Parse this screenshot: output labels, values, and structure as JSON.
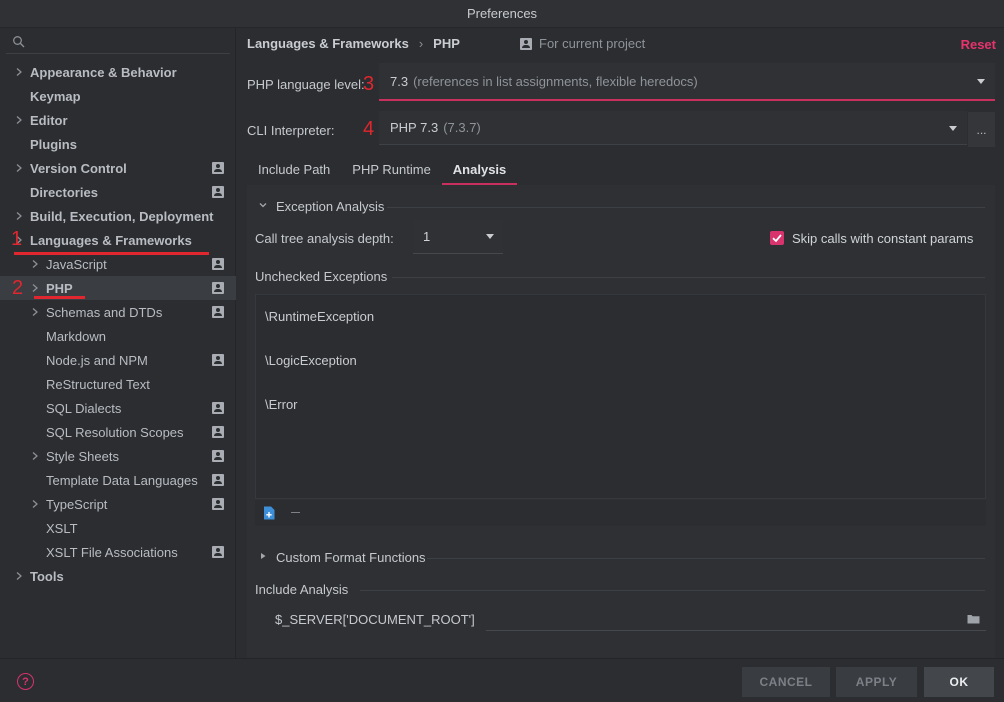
{
  "window": {
    "title": "Preferences"
  },
  "sidebar": {
    "search_placeholder": "",
    "items": [
      {
        "label": "Appearance & Behavior",
        "level": 0,
        "expandable": true,
        "bold": true,
        "project_icon": false
      },
      {
        "label": "Keymap",
        "level": 0,
        "expandable": false,
        "bold": true,
        "project_icon": false
      },
      {
        "label": "Editor",
        "level": 0,
        "expandable": true,
        "bold": true,
        "project_icon": false
      },
      {
        "label": "Plugins",
        "level": 0,
        "expandable": false,
        "bold": true,
        "project_icon": false
      },
      {
        "label": "Version Control",
        "level": 0,
        "expandable": true,
        "bold": true,
        "project_icon": true
      },
      {
        "label": "Directories",
        "level": 0,
        "expandable": false,
        "bold": true,
        "project_icon": true
      },
      {
        "label": "Build, Execution, Deployment",
        "level": 0,
        "expandable": true,
        "bold": true,
        "project_icon": false
      },
      {
        "label": "Languages & Frameworks",
        "level": 0,
        "expandable": true,
        "bold": true,
        "project_icon": false
      },
      {
        "label": "JavaScript",
        "level": 1,
        "expandable": true,
        "bold": false,
        "project_icon": true
      },
      {
        "label": "PHP",
        "level": 1,
        "expandable": true,
        "bold": true,
        "project_icon": true,
        "selected": true
      },
      {
        "label": "Schemas and DTDs",
        "level": 1,
        "expandable": true,
        "bold": false,
        "project_icon": true
      },
      {
        "label": "Markdown",
        "level": 1,
        "expandable": false,
        "bold": false,
        "project_icon": false
      },
      {
        "label": "Node.js and NPM",
        "level": 1,
        "expandable": false,
        "bold": false,
        "project_icon": true
      },
      {
        "label": "ReStructured Text",
        "level": 1,
        "expandable": false,
        "bold": false,
        "project_icon": false
      },
      {
        "label": "SQL Dialects",
        "level": 1,
        "expandable": false,
        "bold": false,
        "project_icon": true
      },
      {
        "label": "SQL Resolution Scopes",
        "level": 1,
        "expandable": false,
        "bold": false,
        "project_icon": true
      },
      {
        "label": "Style Sheets",
        "level": 1,
        "expandable": true,
        "bold": false,
        "project_icon": true
      },
      {
        "label": "Template Data Languages",
        "level": 1,
        "expandable": false,
        "bold": false,
        "project_icon": true
      },
      {
        "label": "TypeScript",
        "level": 1,
        "expandable": true,
        "bold": false,
        "project_icon": true
      },
      {
        "label": "XSLT",
        "level": 1,
        "expandable": false,
        "bold": false,
        "project_icon": false
      },
      {
        "label": "XSLT File Associations",
        "level": 1,
        "expandable": false,
        "bold": false,
        "project_icon": true
      },
      {
        "label": "Tools",
        "level": 0,
        "expandable": true,
        "bold": true,
        "project_icon": false
      }
    ]
  },
  "annotations": {
    "a1": "1",
    "a2": "2",
    "a3": "3",
    "a4": "4",
    "color": "#e0262e"
  },
  "header": {
    "crumb_parent": "Languages & Frameworks",
    "crumb_separator": "›",
    "crumb_current": "PHP",
    "scope_label": "For current project",
    "reset_label": "Reset"
  },
  "php_level": {
    "label": "PHP language level:",
    "value": "7.3",
    "description": "(references in list assignments, flexible heredocs)"
  },
  "cli": {
    "label": "CLI Interpreter:",
    "value": "PHP 7.3",
    "version": "(7.3.7)",
    "more_label": "..."
  },
  "tabs": [
    {
      "label": "Include Path",
      "active": false
    },
    {
      "label": "PHP Runtime",
      "active": false
    },
    {
      "label": "Analysis",
      "active": true
    }
  ],
  "analysis": {
    "exception_analysis_title": "Exception Analysis",
    "depth_label": "Call tree analysis depth:",
    "depth_value": "1",
    "skip_calls_label": "Skip calls with constant params",
    "skip_calls_checked": true,
    "unchecked_title": "Unchecked Exceptions",
    "unchecked_items": [
      "\\RuntimeException",
      "\\LogicException",
      "\\Error"
    ],
    "custom_format_title": "Custom Format Functions",
    "include_analysis_title": "Include Analysis",
    "include_var": "$_SERVER['DOCUMENT_ROOT']",
    "include_path_value": ""
  },
  "footer": {
    "help_label": "?",
    "cancel_label": "CANCEL",
    "apply_label": "APPLY",
    "ok_label": "OK"
  },
  "colors": {
    "accent": "#e8336d",
    "selection": "#3a3d42",
    "background": "#2b2d30"
  }
}
